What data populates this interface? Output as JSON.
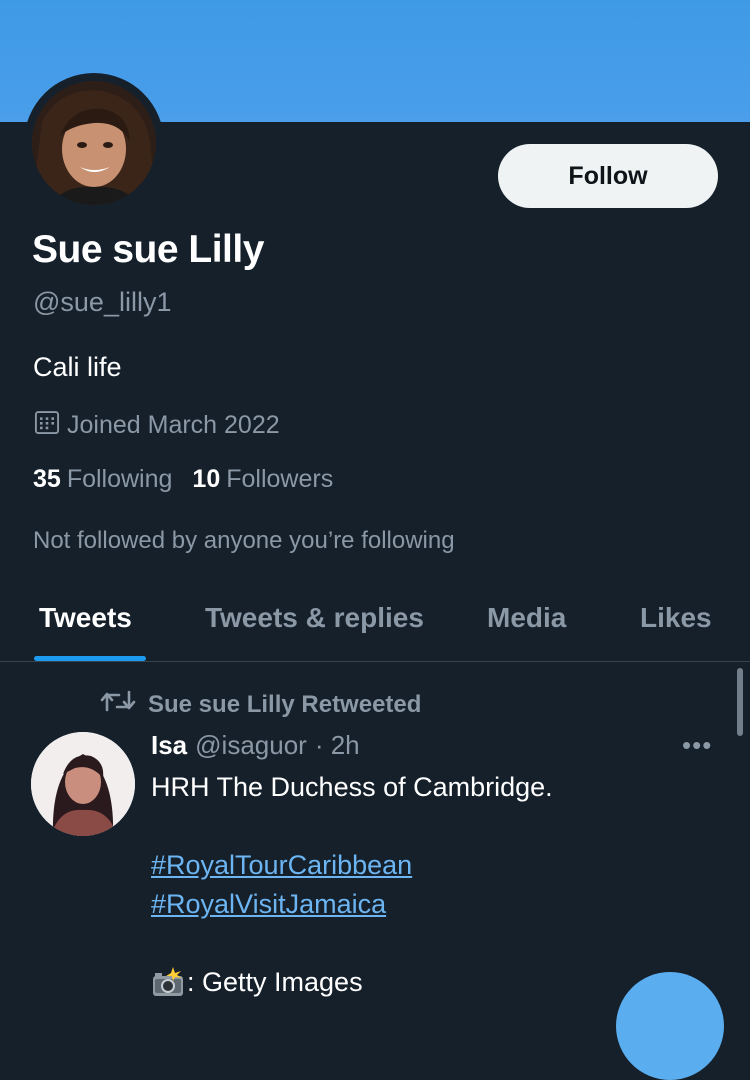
{
  "colors": {
    "background": "#15202b",
    "banner": "#4a9eea",
    "accent": "#1d9bf0",
    "muted": "#8b98a5",
    "link": "#6cb5f2"
  },
  "profile": {
    "name": "Sue sue Lilly",
    "handle": "@sue_lilly1",
    "bio": "Cali life",
    "joined": "Joined March 2022",
    "following_count": "35",
    "following_label": "Following",
    "followers_count": "10",
    "followers_label": "Followers",
    "not_followed_note": "Not followed by anyone you’re following",
    "follow_label": "Follow"
  },
  "tabs": [
    {
      "label": "Tweets",
      "active": true
    },
    {
      "label": "Tweets & replies",
      "active": false
    },
    {
      "label": "Media",
      "active": false
    },
    {
      "label": "Likes",
      "active": false
    }
  ],
  "tweet": {
    "retweeted_by": "Sue sue Lilly Retweeted",
    "author": "Isa",
    "author_handle": "@isaguor",
    "time": "· 2h",
    "text_line1": "HRH The Duchess of Cambridge.",
    "hashtag1": "#RoyalTourCaribbean",
    "hashtag2": "#RoyalVisitJamaica",
    "credit": ": Getty Images",
    "more": "•••"
  },
  "icons": {
    "calendar": "calendar-icon",
    "retweet": "retweet-icon",
    "camera": "camera-flash-icon",
    "more": "more-icon"
  }
}
